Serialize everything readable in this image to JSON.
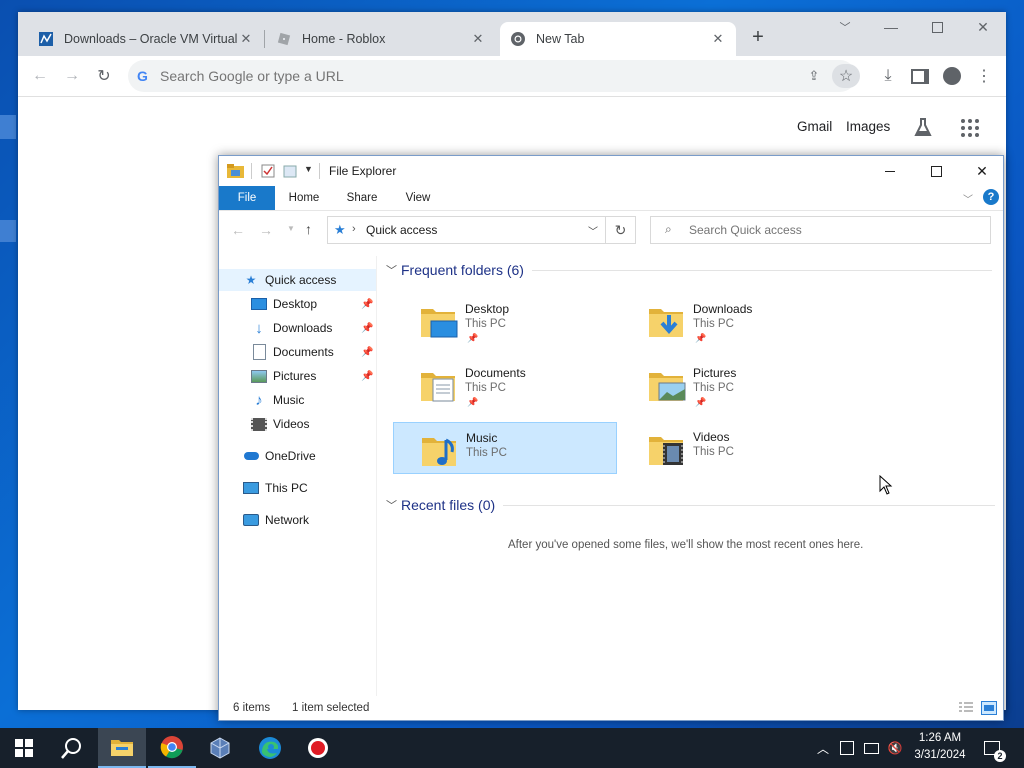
{
  "chrome": {
    "tabs": [
      {
        "title": "Downloads – Oracle VM VirtualBox",
        "favicon": "virtualbox-icon"
      },
      {
        "title": "Home - Roblox",
        "favicon": "roblox-icon"
      },
      {
        "title": "New Tab",
        "favicon": "chrome-icon"
      }
    ],
    "omnibox_placeholder": "Search Google or type a URL",
    "ntp_links": {
      "gmail": "Gmail",
      "images": "Images"
    }
  },
  "explorer": {
    "title": "File Explorer",
    "ribbon_tabs": [
      "File",
      "Home",
      "Share",
      "View"
    ],
    "address": "Quick access",
    "search_placeholder": "Search Quick access",
    "nav": [
      {
        "label": "Quick access"
      },
      {
        "label": "Desktop"
      },
      {
        "label": "Downloads"
      },
      {
        "label": "Documents"
      },
      {
        "label": "Pictures"
      },
      {
        "label": "Music"
      },
      {
        "label": "Videos"
      },
      {
        "label": "OneDrive"
      },
      {
        "label": "This PC"
      },
      {
        "label": "Network"
      }
    ],
    "frequent_header": "Frequent folders (6)",
    "folders": [
      {
        "name": "Desktop",
        "location": "This PC"
      },
      {
        "name": "Downloads",
        "location": "This PC"
      },
      {
        "name": "Documents",
        "location": "This PC"
      },
      {
        "name": "Pictures",
        "location": "This PC"
      },
      {
        "name": "Music",
        "location": "This PC"
      },
      {
        "name": "Videos",
        "location": "This PC"
      }
    ],
    "recent_header": "Recent files (0)",
    "recent_empty": "After you've opened some files, we'll show the most recent ones here.",
    "status": {
      "items": "6 items",
      "selected": "1 item selected"
    }
  },
  "taskbar": {
    "time": "1:26 AM",
    "date": "3/31/2024",
    "notification_count": "2"
  },
  "colors": {
    "accent": "#1979ca",
    "selection": "#cce8ff",
    "taskbar": "#17202b"
  }
}
